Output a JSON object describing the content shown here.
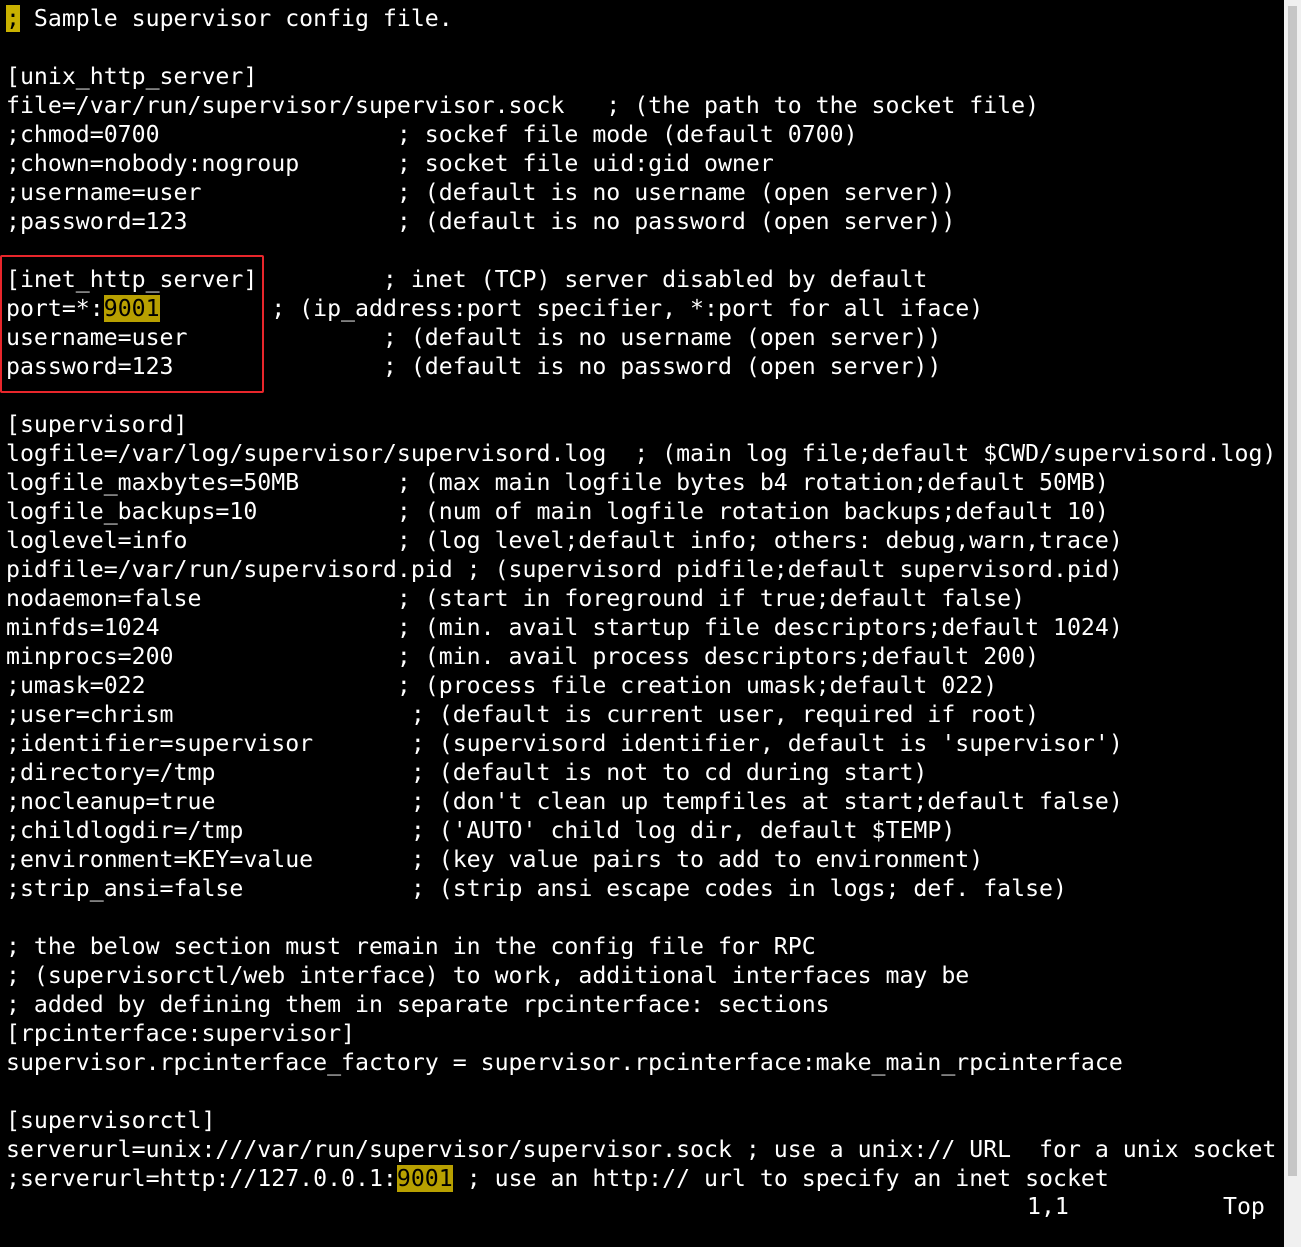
{
  "editor": {
    "lines": [
      {
        "parts": [
          {
            "t": ";",
            "cls": "cursor"
          },
          {
            "t": " Sample supervisor config file."
          }
        ]
      },
      {
        "parts": []
      },
      {
        "parts": [
          {
            "t": "[unix_http_server]"
          }
        ]
      },
      {
        "parts": [
          {
            "t": "file=/var/run/supervisor/supervisor.sock   ; (the path to the socket file)"
          }
        ]
      },
      {
        "parts": [
          {
            "t": ";chmod=0700                 ; sockef file mode (default 0700)"
          }
        ]
      },
      {
        "parts": [
          {
            "t": ";chown=nobody:nogroup       ; socket file uid:gid owner"
          }
        ]
      },
      {
        "parts": [
          {
            "t": ";username=user              ; (default is no username (open server))"
          }
        ]
      },
      {
        "parts": [
          {
            "t": ";password=123               ; (default is no password (open server))"
          }
        ]
      },
      {
        "parts": []
      },
      {
        "parts": [
          {
            "t": "[inet_http_server]         ; inet (TCP) server disabled by default"
          }
        ]
      },
      {
        "parts": [
          {
            "t": "port=*:"
          },
          {
            "t": "9001",
            "cls": "hl"
          },
          {
            "t": "        ; (ip_address:port specifier, *:port for all iface)"
          }
        ]
      },
      {
        "parts": [
          {
            "t": "username=user              ; (default is no username (open server))"
          }
        ]
      },
      {
        "parts": [
          {
            "t": "password=123               ; (default is no password (open server))"
          }
        ]
      },
      {
        "parts": []
      },
      {
        "parts": [
          {
            "t": "[supervisord]"
          }
        ]
      },
      {
        "parts": [
          {
            "t": "logfile=/var/log/supervisor/supervisord.log  ; (main log file;default $CWD/supervisord.log)"
          }
        ]
      },
      {
        "parts": [
          {
            "t": "logfile_maxbytes=50MB       ; (max main logfile bytes b4 rotation;default 50MB)"
          }
        ]
      },
      {
        "parts": [
          {
            "t": "logfile_backups=10          ; (num of main logfile rotation backups;default 10)"
          }
        ]
      },
      {
        "parts": [
          {
            "t": "loglevel=info               ; (log level;default info; others: debug,warn,trace)"
          }
        ]
      },
      {
        "parts": [
          {
            "t": "pidfile=/var/run/supervisord.pid ; (supervisord pidfile;default supervisord.pid)"
          }
        ]
      },
      {
        "parts": [
          {
            "t": "nodaemon=false              ; (start in foreground if true;default false)"
          }
        ]
      },
      {
        "parts": [
          {
            "t": "minfds=1024                 ; (min. avail startup file descriptors;default 1024)"
          }
        ]
      },
      {
        "parts": [
          {
            "t": "minprocs=200                ; (min. avail process descriptors;default 200)"
          }
        ]
      },
      {
        "parts": [
          {
            "t": ";umask=022                  ; (process file creation umask;default 022)"
          }
        ]
      },
      {
        "parts": [
          {
            "t": ";user=chrism                 ; (default is current user, required if root)"
          }
        ]
      },
      {
        "parts": [
          {
            "t": ";identifier=supervisor       ; (supervisord identifier, default is 'supervisor')"
          }
        ]
      },
      {
        "parts": [
          {
            "t": ";directory=/tmp              ; (default is not to cd during start)"
          }
        ]
      },
      {
        "parts": [
          {
            "t": ";nocleanup=true              ; (don't clean up tempfiles at start;default false)"
          }
        ]
      },
      {
        "parts": [
          {
            "t": ";childlogdir=/tmp            ; ('AUTO' child log dir, default $TEMP)"
          }
        ]
      },
      {
        "parts": [
          {
            "t": ";environment=KEY=value       ; (key value pairs to add to environment)"
          }
        ]
      },
      {
        "parts": [
          {
            "t": ";strip_ansi=false            ; (strip ansi escape codes in logs; def. false)"
          }
        ]
      },
      {
        "parts": []
      },
      {
        "parts": [
          {
            "t": "; the below section must remain in the config file for RPC"
          }
        ]
      },
      {
        "parts": [
          {
            "t": "; (supervisorctl/web interface) to work, additional interfaces may be"
          }
        ]
      },
      {
        "parts": [
          {
            "t": "; added by defining them in separate rpcinterface: sections"
          }
        ]
      },
      {
        "parts": [
          {
            "t": "[rpcinterface:supervisor]"
          }
        ]
      },
      {
        "parts": [
          {
            "t": "supervisor.rpcinterface_factory = supervisor.rpcinterface:make_main_rpcinterface"
          }
        ]
      },
      {
        "parts": []
      },
      {
        "parts": [
          {
            "t": "[supervisorctl]"
          }
        ]
      },
      {
        "parts": [
          {
            "t": "serverurl=unix:///var/run/supervisor/supervisor.sock ; use a unix:// URL  for a unix socket"
          }
        ]
      },
      {
        "parts": [
          {
            "t": ";serverurl=http://127.0.0.1:"
          },
          {
            "t": "9001",
            "cls": "hl"
          },
          {
            "t": " ; use an http:// url to specify an inet socket"
          }
        ]
      }
    ]
  },
  "status": {
    "cursor_position": "1,1",
    "scroll_position": "Top"
  },
  "colors": {
    "background": "#000000",
    "foreground": "#ffffff",
    "search_highlight": "#b8a000",
    "annotation_box": "#e8262b",
    "scrollbar_track": "#f0f0f0",
    "scrollbar_thumb": "#c6c6c6"
  }
}
